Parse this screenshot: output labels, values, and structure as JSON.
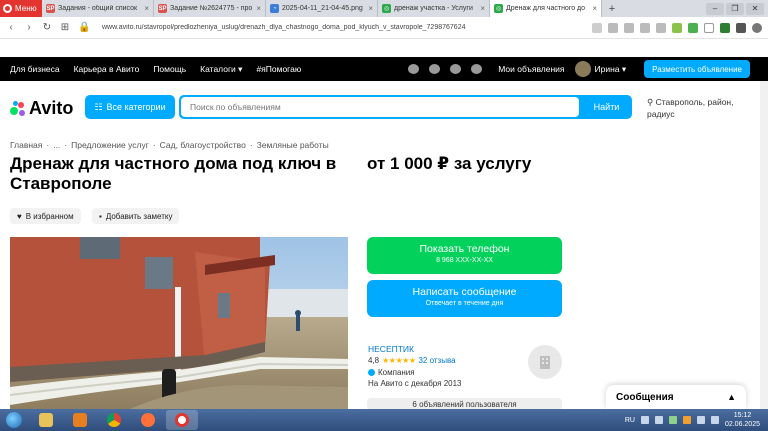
{
  "browser": {
    "menu_label": "Меню",
    "tabs": [
      {
        "title": "Задания - общий список",
        "icon_text": "SP",
        "icon_color": "#d9534f",
        "active": false
      },
      {
        "title": "Задание №2624775 - про",
        "icon_text": "SP",
        "icon_color": "#d9534f",
        "active": false
      },
      {
        "title": "2025-04-11_21-04-45.png",
        "icon_text": "◔",
        "icon_color": "#3b7dd8",
        "active": false
      },
      {
        "title": "дренаж участка - Услуги",
        "icon_text": "◎",
        "icon_color": "#2aa84a",
        "active": false
      },
      {
        "title": "Дренаж для частного до",
        "icon_text": "◎",
        "icon_color": "#2aa84a",
        "active": true
      }
    ],
    "new_tab": "+",
    "url": "www.avito.ru/stavropol/predlozheniya_uslug/drenazh_dlya_chastnogo_doma_pod_klyuch_v_stavropole_7298767624"
  },
  "topnav": {
    "links": [
      "Для бизнеса",
      "Карьера в Авито",
      "Помощь",
      "Каталоги ▾",
      "#яПомогаю"
    ],
    "my_ads": "Мои объявления",
    "user_name": "Ирина ▾",
    "post_button": "Разместить объявление"
  },
  "header": {
    "logo_text": "Avito",
    "categories_button": "Все категории",
    "search_placeholder": "Поиск по объявлениям",
    "search_button": "Найти",
    "location": "Ставрополь, район, радиус"
  },
  "breadcrumb": [
    "Главная",
    "·",
    "...",
    "·",
    "Предложение услуг",
    "·",
    "Сад, благоустройство",
    "·",
    "Земляные работы"
  ],
  "listing": {
    "title": "Дренаж для частного дома под ключ в Ставрополе",
    "price": "от 1 000 ₽ за услугу",
    "favorite_button": "В избранном",
    "note_button": "Добавить заметку"
  },
  "contact": {
    "phone_button": "Показать телефон",
    "phone_masked": "8 968 XXX-XX-XX",
    "message_button": "Написать сообщение",
    "message_sub": "Отвечает в течение дня"
  },
  "seller": {
    "name": "НЕСЕПТИК",
    "rating": "4,8",
    "stars": "★★★★★",
    "reviews": "32 отзыва",
    "type": "Компания",
    "since": "На Авито с декабря 2013",
    "ads_button": "6 объявлений пользователя"
  },
  "messages_widget": {
    "title": "Сообщения",
    "chevron": "▲"
  },
  "taskbar": {
    "lang": "RU",
    "time": "15:12",
    "date": "02.06.2025"
  },
  "colors": {
    "avito_blue": "#00aaff",
    "phone_green": "#02d15c",
    "opera_red": "#e3342f"
  }
}
